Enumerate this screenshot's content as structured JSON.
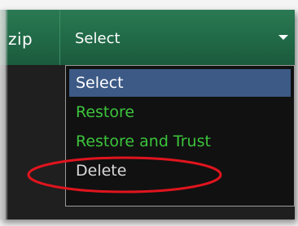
{
  "file_label": "zip",
  "select": {
    "value": "Select",
    "options": [
      {
        "label": "Select",
        "selected": true
      },
      {
        "label": "Restore",
        "selected": false
      },
      {
        "label": "Restore and Trust",
        "selected": false
      },
      {
        "label": "Delete",
        "selected": false
      }
    ]
  },
  "colors": {
    "header": "#226c49",
    "dropdown_bg": "#111111",
    "selected_bg": "#3d5a86",
    "option_text": "#3cc43c",
    "annotation": "#e0141e"
  },
  "icons": {
    "caret": "chevron-down-icon"
  }
}
